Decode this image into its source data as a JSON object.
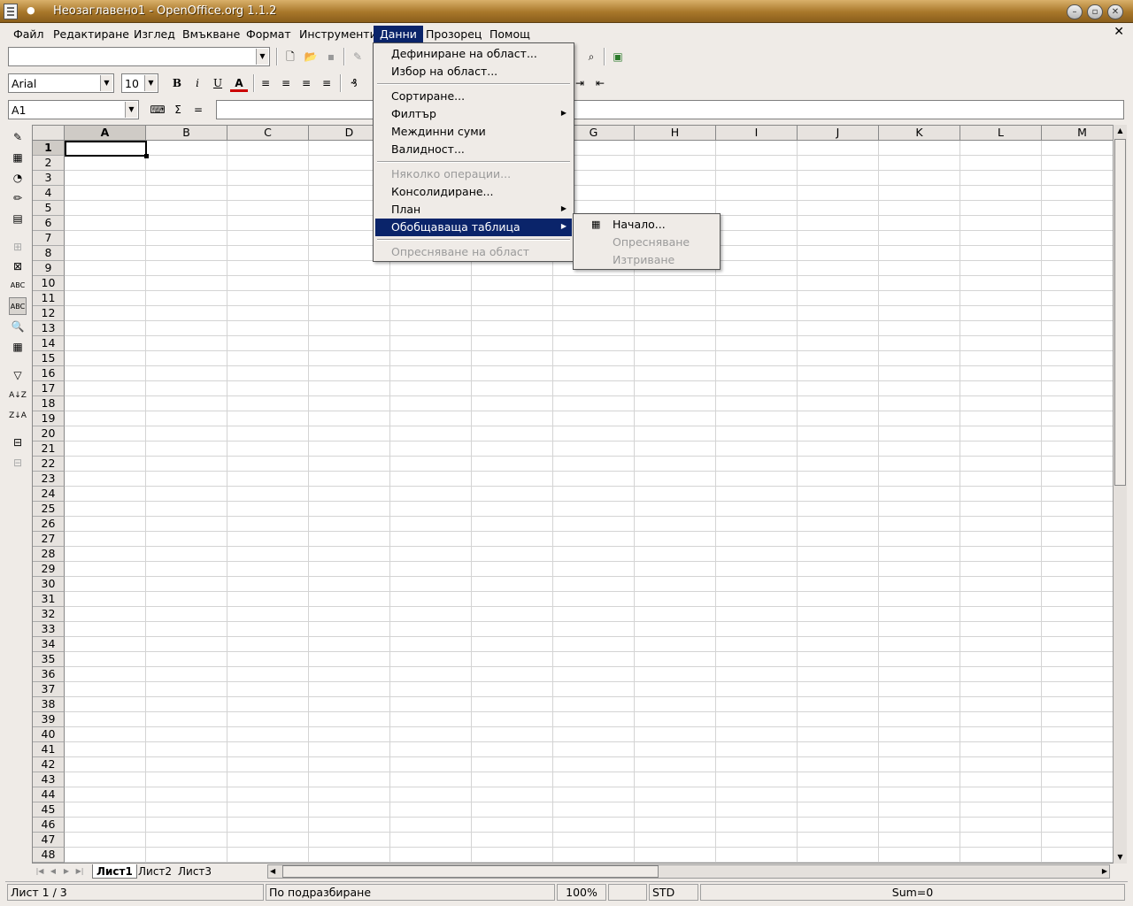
{
  "window": {
    "title": "Неозаглавено1 - OpenOffice.org 1.1.2",
    "controls": [
      "minimize-icon",
      "maximize-icon",
      "close-icon"
    ]
  },
  "menubar": {
    "items": [
      "Файл",
      "Редактиране",
      "Изглед",
      "Вмъкване",
      "Формат",
      "Инструменти",
      "Данни",
      "Прозорец",
      "Помощ"
    ],
    "active": "Данни",
    "close_doc": "✕"
  },
  "toolbar": {
    "url_value": "",
    "font_name": "Arial",
    "font_size": "10",
    "bold": "B",
    "italic": "i",
    "underline": "U",
    "font_color": "A"
  },
  "formulabar": {
    "name_box": "A1",
    "sum_symbol": "Σ",
    "equals_symbol": "=",
    "formula_value": ""
  },
  "sheet": {
    "columns": [
      "A",
      "B",
      "C",
      "D",
      "E",
      "F",
      "G",
      "H",
      "I",
      "J",
      "K",
      "L",
      "M"
    ],
    "rows": [
      "1",
      "2",
      "3",
      "4",
      "5",
      "6",
      "7",
      "8",
      "9",
      "10",
      "11",
      "12",
      "13",
      "14",
      "15",
      "16",
      "17",
      "18",
      "19",
      "20",
      "21",
      "22",
      "23",
      "24",
      "25",
      "26",
      "27",
      "28",
      "29",
      "30",
      "31",
      "32",
      "33",
      "34",
      "35",
      "36",
      "37",
      "38",
      "39",
      "40",
      "41",
      "42",
      "43",
      "44",
      "45",
      "46",
      "47",
      "48"
    ],
    "active_cell": "A1"
  },
  "tabs": {
    "sheets": [
      "Лист1",
      "Лист2",
      "Лист3"
    ],
    "active": "Лист1"
  },
  "statusbar": {
    "sheet_info": "Лист 1 / 3",
    "page_style": "По подразбиране",
    "zoom": "100%",
    "mode": "STD",
    "sum": "Sum=0"
  },
  "data_menu": {
    "items": [
      {
        "label": "Дефиниране на област...",
        "enabled": true
      },
      {
        "label": "Избор на област...",
        "enabled": true
      },
      {
        "label": "Сортиране...",
        "enabled": true
      },
      {
        "label": "Филтър",
        "enabled": true,
        "submenu": true
      },
      {
        "label": "Междинни суми",
        "enabled": true
      },
      {
        "label": "Валидност...",
        "enabled": true
      },
      {
        "label": "Няколко операции...",
        "enabled": false
      },
      {
        "label": "Консолидиране...",
        "enabled": true
      },
      {
        "label": "План",
        "enabled": true,
        "submenu": true
      },
      {
        "label": "Обобщаваща таблица",
        "enabled": true,
        "submenu": true,
        "highlighted": true
      },
      {
        "label": "Опресняване на област",
        "enabled": false
      }
    ]
  },
  "pivot_submenu": {
    "items": [
      {
        "label": "Начало...",
        "enabled": true
      },
      {
        "label": "Опресняване",
        "enabled": false
      },
      {
        "label": "Изтриване",
        "enabled": false
      }
    ]
  },
  "colors": {
    "title_bar": "#a8772a",
    "menu_highlight": "#0a246a",
    "window_bg": "#efebe7"
  }
}
